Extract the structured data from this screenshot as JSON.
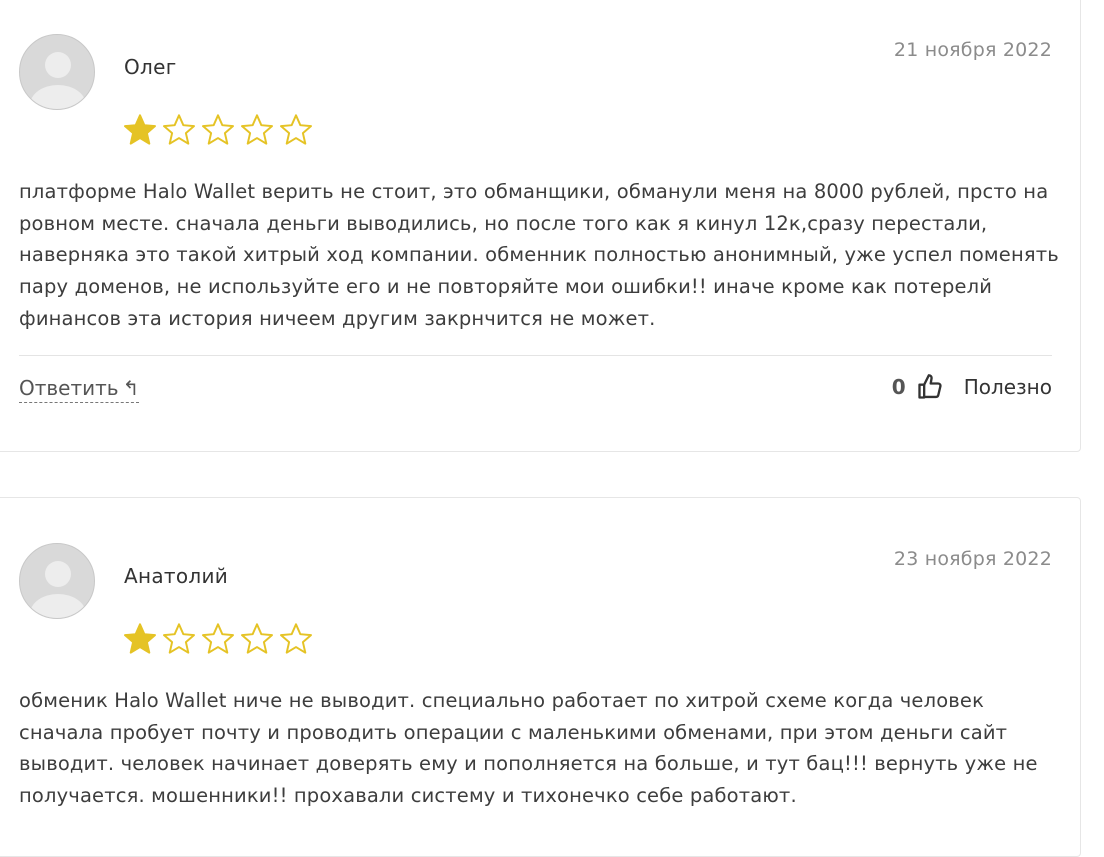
{
  "reviews": [
    {
      "author": "Олег",
      "date": "21 ноября 2022",
      "rating": 1,
      "max_rating": 5,
      "text": "платформе Halo Wallet верить не стоит, это обманщики, обманули меня на 8000 рублей, прсто на ровном месте. сначала деньги выводились, но после того как я кинул 12к,сразу перестали, наверняка это такой хитрый ход компании. обменник полностью анонимный, уже успел поменять пару доменов, не используйте его и не повторяйте мои ошибки!! иначе кроме как потерелй финансов эта история ничеем другим закрнчится не может.",
      "reply_label": "Ответить",
      "helpful_count": "0",
      "helpful_label": "Полезно"
    },
    {
      "author": "Анатолий",
      "date": "23 ноября 2022",
      "rating": 1,
      "max_rating": 5,
      "text": "обменик Halo Wallet ниче не выводит. специально работает по хитрой схеме когда человек сначала пробует почту и проводить операции с маленькими обменами, при этом деньги сайт выводит. человек начинает доверять ему и пополняется на больше, и тут бац!!! вернуть уже не получается. мошенники!! прохавали систему и тихонечко себе работают."
    }
  ],
  "colors": {
    "star_filled": "#e5c325",
    "star_outline": "#e5c325"
  }
}
